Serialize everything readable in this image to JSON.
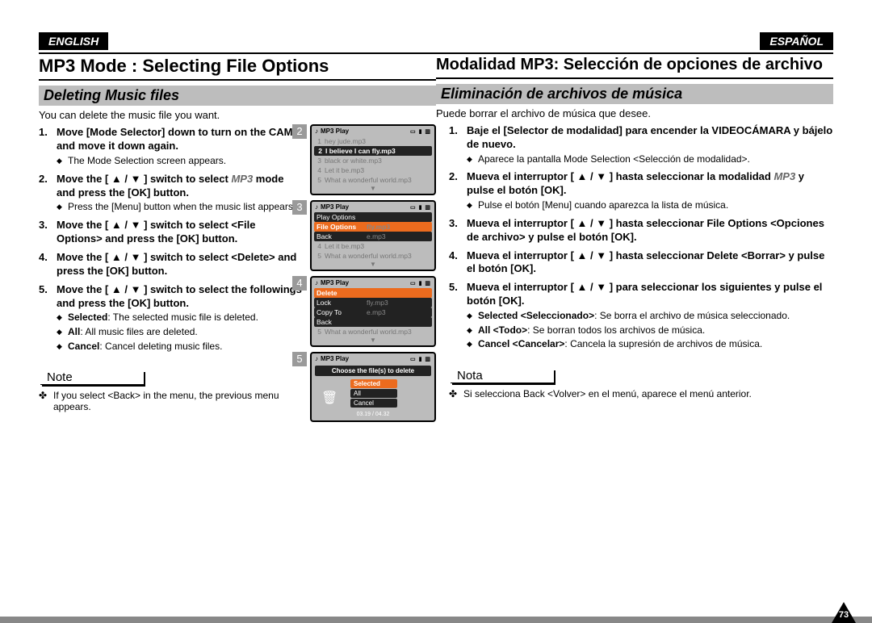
{
  "page_number": "73",
  "left": {
    "lang": "ENGLISH",
    "h1": "MP3 Mode : Selecting File Options",
    "h2": "Deleting Music files",
    "intro": "You can delete the music file you want.",
    "steps": [
      {
        "title": "Move [Mode Selector] down to turn on the CAM and move it down again.",
        "sub": [
          "The Mode Selection screen appears."
        ]
      },
      {
        "title_pre": "Move the [ ▲ / ▼ ] switch to select ",
        "mode": "MP3",
        "title_post": " mode and press the [OK] button.",
        "sub": [
          "Press the [Menu] button when the music list appears."
        ]
      },
      {
        "title": "Move the [ ▲ / ▼ ] switch to select <File Options> and press the [OK] button."
      },
      {
        "title": "Move the [ ▲ / ▼ ] switch to select <Delete> and press the [OK] button."
      },
      {
        "title": "Move the [ ▲ / ▼ ] switch to select the followings and press the [OK] button.",
        "sub_kv": [
          {
            "k": "Selected",
            "v": ": The selected music file is deleted."
          },
          {
            "k": "All",
            "v": ": All music files are deleted."
          },
          {
            "k": "Cancel",
            "v": ": Cancel deleting music files."
          }
        ]
      }
    ],
    "note_label": "Note",
    "note_items": [
      "If you select <Back> in the menu, the previous menu appears."
    ]
  },
  "right": {
    "lang": "ESPAÑOL",
    "h1": "Modalidad MP3: Selección de opciones de archivo",
    "h2": "Eliminación de archivos de música",
    "intro": "Puede borrar el archivo de música que desee.",
    "steps": [
      {
        "title": "Baje el [Selector de modalidad] para encender la VIDEOCÁMARA y bájelo de nuevo.",
        "sub": [
          "Aparece la pantalla Mode Selection <Selección de modalidad>."
        ]
      },
      {
        "title_pre": "Mueva el interruptor [ ▲ / ▼ ] hasta seleccionar la modalidad ",
        "mode": "MP3",
        "title_post": " y pulse el botón [OK].",
        "sub": [
          "Pulse el botón [Menu] cuando aparezca la lista de música."
        ]
      },
      {
        "title": "Mueva el interruptor [ ▲ / ▼ ] hasta seleccionar File Options <Opciones de archivo> y pulse el botón [OK]."
      },
      {
        "title": "Mueva el interruptor [ ▲ / ▼ ] hasta seleccionar Delete <Borrar> y pulse el botón [OK]."
      },
      {
        "title": "Mueva el interruptor [ ▲ / ▼ ] para seleccionar los siguientes y pulse el botón [OK].",
        "sub_kv": [
          {
            "k": "Selected <Seleccionado>",
            "v": ": Se borra el archivo de música seleccionado."
          },
          {
            "k": "All <Todo>",
            "v": ": Se borran todos los archivos de música."
          },
          {
            "k": "Cancel <Cancelar>",
            "v": ": Cancela la supresión de archivos de música."
          }
        ]
      }
    ],
    "note_label": "Nota",
    "note_items": [
      "Si selecciona Back <Volver> en el menú, aparece el menú anterior."
    ]
  },
  "screens": {
    "title": "MP3 Play",
    "s2": {
      "num": "2",
      "rows": [
        {
          "n": "1",
          "t": "hey jude.mp3",
          "sel": false
        },
        {
          "n": "2",
          "t": "I believe I can fly.mp3",
          "sel": true
        },
        {
          "n": "3",
          "t": "black or white.mp3",
          "sel": false
        },
        {
          "n": "4",
          "t": "Let it be.mp3",
          "sel": false
        },
        {
          "n": "5",
          "t": "What a wonderful world.mp3",
          "sel": false
        }
      ]
    },
    "s3": {
      "num": "3",
      "menu": [
        {
          "label": "Play Options",
          "ghost": "",
          "active": false
        },
        {
          "label": "File Options",
          "ghost": "fly.mp3",
          "active": true
        },
        {
          "label": "Back",
          "ghost": "e.mp3",
          "active": false
        }
      ],
      "rows": [
        {
          "n": "4",
          "t": "Let it be.mp3"
        },
        {
          "n": "5",
          "t": "What a wonderful world.mp3"
        }
      ]
    },
    "s4": {
      "num": "4",
      "menu": [
        {
          "label": "Delete",
          "ghost": "",
          "active": true
        },
        {
          "label": "Lock",
          "ghost": "fly.mp3",
          "active": false
        },
        {
          "label": "Copy To",
          "ghost": "e.mp3",
          "active": false
        },
        {
          "label": "Back",
          "ghost": "",
          "active": false
        }
      ],
      "rows": [
        {
          "n": "5",
          "t": "What a wonderful world.mp3"
        }
      ]
    },
    "s5": {
      "num": "5",
      "prompt": "Choose the file(s) to delete",
      "options": [
        {
          "label": "Selected",
          "active": true
        },
        {
          "label": "All",
          "active": false
        },
        {
          "label": "Cancel",
          "active": false
        }
      ],
      "time": "03.19 / 04.32"
    }
  }
}
